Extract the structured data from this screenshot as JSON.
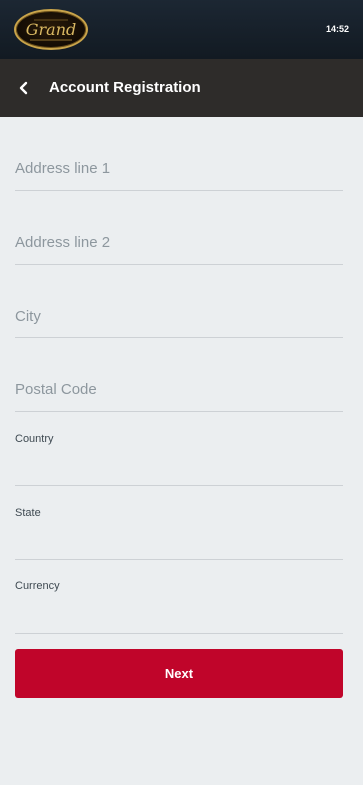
{
  "status": {
    "time": "14:52"
  },
  "brand": {
    "logo": "Grand casino logo",
    "logo_script": "Grand"
  },
  "header": {
    "title": "Account Registration",
    "back_icon": "chevron-left-icon"
  },
  "form": {
    "address1_placeholder": "Address line 1",
    "address2_placeholder": "Address line 2",
    "city_placeholder": "City",
    "postal_placeholder": "Postal Code",
    "country_label": "Country",
    "state_label": "State",
    "currency_label": "Currency",
    "next_label": "Next"
  },
  "colors": {
    "accent": "#c0052a",
    "header_bg": "#2e2c2a",
    "topbar_bg": "#121a22",
    "page_bg": "#ebeef0"
  }
}
